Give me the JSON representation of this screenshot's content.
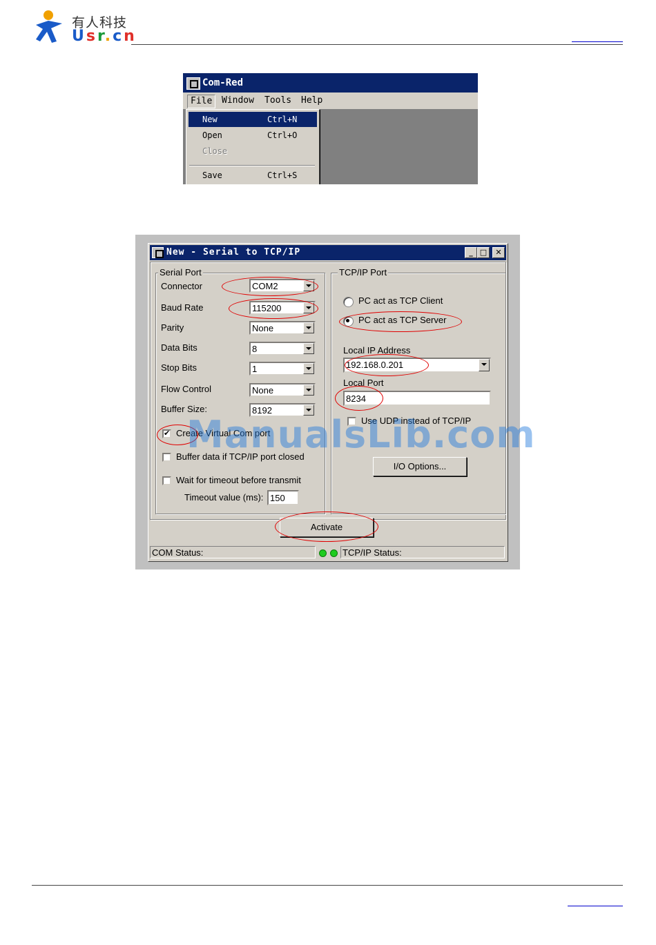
{
  "header": {
    "logo_cn": "有人科技",
    "logo_usr_parts": [
      {
        "text": "U",
        "color": "#1a5bc8"
      },
      {
        "text": "s",
        "color": "#e0302a"
      },
      {
        "text": "r",
        "color": "#1a9a3a"
      },
      {
        "text": ".",
        "color": "#f0a000"
      },
      {
        "text": "c",
        "color": "#1a5bc8"
      },
      {
        "text": "n",
        "color": "#e0302a"
      }
    ]
  },
  "menu_screenshot": {
    "title": "Com-Red",
    "menubar": [
      "File",
      "Window",
      "Tools",
      "Help"
    ],
    "file_menu": [
      {
        "label": "New",
        "shortcut": "Ctrl+N"
      },
      {
        "label": "Open",
        "shortcut": "Ctrl+O"
      },
      {
        "label": "Close",
        "shortcut": ""
      },
      {
        "label": "Save",
        "shortcut": "Ctrl+S"
      }
    ]
  },
  "dialog": {
    "title": "New - Serial to TCP/IP",
    "serial_port": {
      "group_title": "Serial Port",
      "connector_label": "Connector",
      "connector_value": "COM2",
      "baud_label": "Baud Rate",
      "baud_value": "115200",
      "parity_label": "Parity",
      "parity_value": "None",
      "databits_label": "Data Bits",
      "databits_value": "8",
      "stopbits_label": "Stop Bits",
      "stopbits_value": "1",
      "flow_label": "Flow Control",
      "flow_value": "None",
      "buffer_label": "Buffer Size:",
      "buffer_value": "8192",
      "create_virtual_label": "Create Virtual Com port",
      "buffer_closed_label": "Buffer data if TCP/IP port closed",
      "wait_timeout_label": "Wait for timeout before transmit",
      "timeout_label": "Timeout value (ms):",
      "timeout_value": "150"
    },
    "tcpip_port": {
      "group_title": "TCP/IP Port",
      "client_label": "PC act as TCP Client",
      "server_label": "PC act as TCP Server",
      "local_ip_label": "Local IP Address",
      "local_ip_value": "192.168.0.201",
      "local_port_label": "Local Port",
      "local_port_value": "8234",
      "udp_label": "Use UDP instead of TCP/IP",
      "io_options_label": "I/O Options..."
    },
    "activate_label": "Activate",
    "com_status_label": "COM Status:",
    "tcpip_status_label": "TCP/IP Status:"
  },
  "watermark": "ManualsLib.com"
}
